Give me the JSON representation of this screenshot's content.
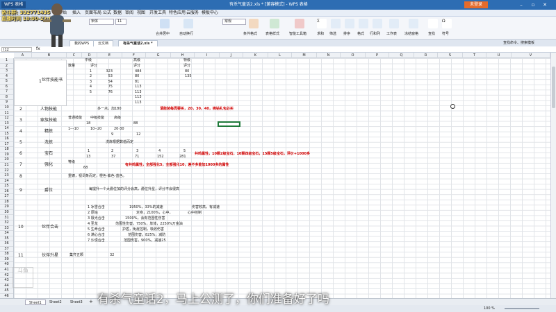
{
  "app": {
    "logo": "WPS 表格",
    "title": "有杀气童话2.xls * [兼容模式] - WPS 表格",
    "login": "未登录"
  },
  "menu": [
    "开始",
    "插入",
    "页面布局",
    "公式",
    "数据",
    "审阅",
    "视图",
    "开发工具",
    "特色应用",
    "云服务",
    "模板中心"
  ],
  "ribbon": {
    "font_name": "宋体",
    "font_size": "11",
    "style_box": "常规",
    "groups": [
      "粘贴",
      "剪切",
      "复制",
      "格式刷",
      "合并居中",
      "自动换行",
      "条件格式",
      "表格样式",
      "智能工具箱",
      "求和",
      "筛选",
      "排序",
      "格式",
      "行和列",
      "工作表",
      "冻结窗格",
      "查找",
      "符号"
    ]
  },
  "doc_tabs": [
    "我的WPS",
    "云文档",
    "有杀气童话2.xls *"
  ],
  "name_box": "I12",
  "search_hint": "查找命令、搜索模板",
  "columns": [
    "A",
    "B",
    "C",
    "D",
    "E",
    "F",
    "G",
    "H",
    "I",
    "J",
    "K",
    "L",
    "M",
    "N",
    "O",
    "P",
    "Q",
    "R",
    "S",
    "T",
    "U",
    "V"
  ],
  "rows": [
    "1",
    "2",
    "3",
    "4",
    "5",
    "6",
    "7",
    "8",
    "9",
    "10",
    "11",
    "12",
    "13",
    "14",
    "15",
    "16",
    "17",
    "18",
    "19",
    "20",
    "21",
    "22",
    "23",
    "24",
    "25",
    "26",
    "27",
    "28",
    "29",
    "30",
    "31",
    "32",
    "33",
    "34",
    "35",
    "36",
    "37",
    "38",
    "39",
    "40",
    "41",
    "42",
    "43",
    "44",
    "45",
    "46"
  ],
  "cells": {
    "companion": "伙伴技能书",
    "mid": "中级",
    "high": "高级",
    "special": "特级",
    "qty": "数量",
    "score": "评分",
    "n1": "1",
    "n2": "2",
    "n3": "3",
    "n4": "4",
    "n5": "5",
    "s323": "323",
    "s53": "53",
    "s54": "54",
    "s75": "75",
    "s76": "76",
    "h484": "484",
    "h80": "80",
    "h81": "81",
    "h113a": "113",
    "h113b": "113",
    "h113c": "113",
    "h113d": "113",
    "sp80": "80",
    "sp135": "135",
    "row1_no": "1",
    "row2_no": "2",
    "person_skill": "人物技能",
    "person_skill_note": "多一点。加180",
    "person_skill_red": "请能装每周要买，20，30，40，绑钻礼包必买",
    "row3_no": "3",
    "family_skill": "家族技能",
    "fam_h1": "普通技能",
    "fam_h2": "中级技能",
    "fam_h3": "高级",
    "fam_v1": "18",
    "fam_v2": "88",
    "row4_no": "4",
    "essence": "精炼",
    "ess_1": "1---10",
    "ess_2": "10--20",
    "ess_3": "20-30",
    "ess_v1": "9",
    "ess_v2": "12",
    "row5_no": "5",
    "wash": "洗炼",
    "wash_note": "洗炼根据数值而定",
    "row6_no": "6",
    "gem": "宝石",
    "g1": "1",
    "g2": "2",
    "g3": "3",
    "g4": "4",
    "g5": "5",
    "gv1": "13",
    "gv2": "37",
    "gv3": "71",
    "gv4": "152",
    "gv5": "281",
    "gem_red": "共鸣属性，10颗2级宝石，10颗四级宝石，15颗5级宝石，评价+1000多",
    "row7_no": "7",
    "enhance": "强化",
    "enh_lv": "等级",
    "enh_v": "68",
    "enh_red": "有共鸣属性，全部强化5，全部强化10，差不多能加1000多的属性",
    "row8_no": "8",
    "row8_note": "重铸，视词条而定，橙色-紫色-蓝色。",
    "row9_no": "9",
    "rank": "爵位",
    "rank_note": "每提升一个大爵位加的评分会高，爵位升星，评分不会很高",
    "row10_no": "10",
    "combo": "伙伴合击",
    "c1": "1 冰雪合击",
    "c1d": "1950%，33%的减速",
    "c1e": "伤害较高，有减速",
    "c2": "2 原始",
    "c2d": "定身，2100%，心中，",
    "c2e": "心中控制",
    "c3": "3 极光合击",
    "c3d": "1500%，会有范围性伤害",
    "c4": "4 圣龙",
    "c4d": "范围性伤害，750%，单体，2250%万金油",
    "c5": "5 生命合击",
    "c5d": "护盾，免疫控制，吸收伤害",
    "c6": "6 满心合击",
    "c6d": "范围伤害，825%，减防",
    "c7": "7 沙漠合击",
    "c7d": "范围伤害，900%，减速25",
    "row11_no": "11",
    "upgrade": "伙伴升星",
    "upg_note": "集齐五颗",
    "upg_v": "32"
  },
  "sheets": [
    "Sheet1",
    "Sheet2",
    "Sheet3"
  ],
  "zoom": "100 %",
  "subtitle": "有杀气童话2，马上公测了，你们准备好了吗",
  "overlay": {
    "line1": "奋斗群: 332771435",
    "line2": "直播时间 18:00-22:00"
  },
  "watermark": "斗鱼"
}
